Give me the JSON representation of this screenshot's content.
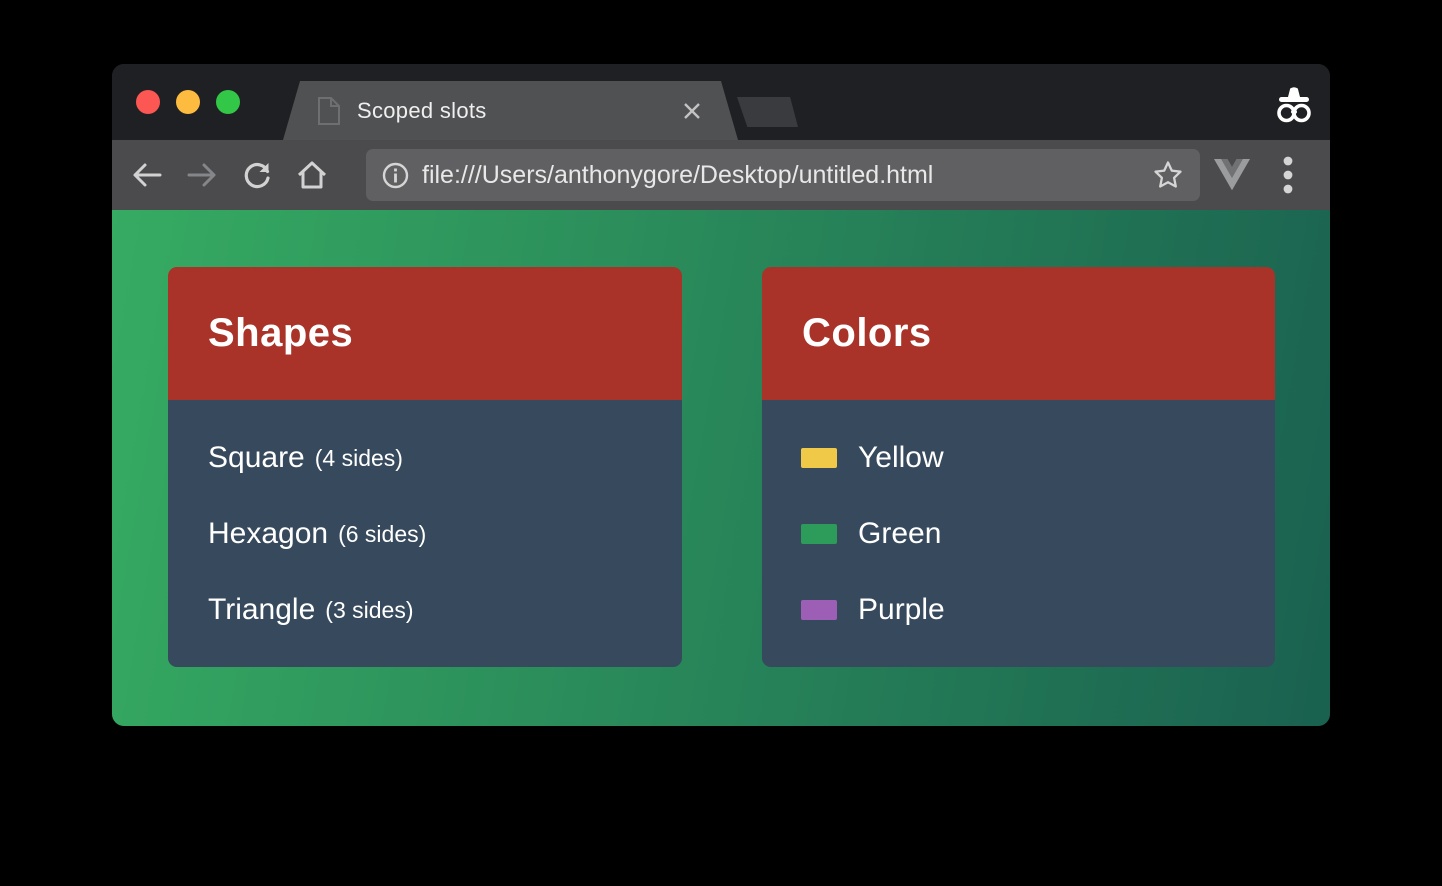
{
  "browser": {
    "tab": {
      "title": "Scoped slots"
    },
    "address_bar": {
      "url": "file:///Users/anthonygore/Desktop/untitled.html"
    },
    "icons": [
      "page-favicon-icon",
      "close-icon",
      "new-tab-button",
      "incognito-icon",
      "arrow-left-icon",
      "arrow-right-icon",
      "reload-icon",
      "home-icon",
      "info-icon",
      "star-icon",
      "vue-devtools-icon",
      "kebab-menu-icon",
      "traffic-close",
      "traffic-minimize",
      "traffic-zoom"
    ]
  },
  "page": {
    "cards": [
      {
        "title": "Shapes",
        "items": [
          {
            "name": "Square",
            "detail": "(4 sides)"
          },
          {
            "name": "Hexagon",
            "detail": "(6 sides)"
          },
          {
            "name": "Triangle",
            "detail": "(3 sides)"
          }
        ]
      },
      {
        "title": "Colors",
        "items": [
          {
            "name": "Yellow",
            "swatch": "#f0c948"
          },
          {
            "name": "Green",
            "swatch": "#2d9b59"
          },
          {
            "name": "Purple",
            "swatch": "#9c5fb5"
          }
        ]
      }
    ]
  },
  "theme": {
    "traffic_close": "#fc5753",
    "traffic_minimize": "#fdbc40",
    "traffic_zoom": "#33c748",
    "tab_strip_bg": "#1f2023",
    "tab_bg": "#505153",
    "toolbar_bg": "#4b4b4d",
    "url_field_bg": "#606062",
    "content_gradient_start": "#36ab62",
    "content_gradient_end": "#1a6150",
    "card_header_bg": "#a93329",
    "card_body_bg": "#37495c"
  }
}
